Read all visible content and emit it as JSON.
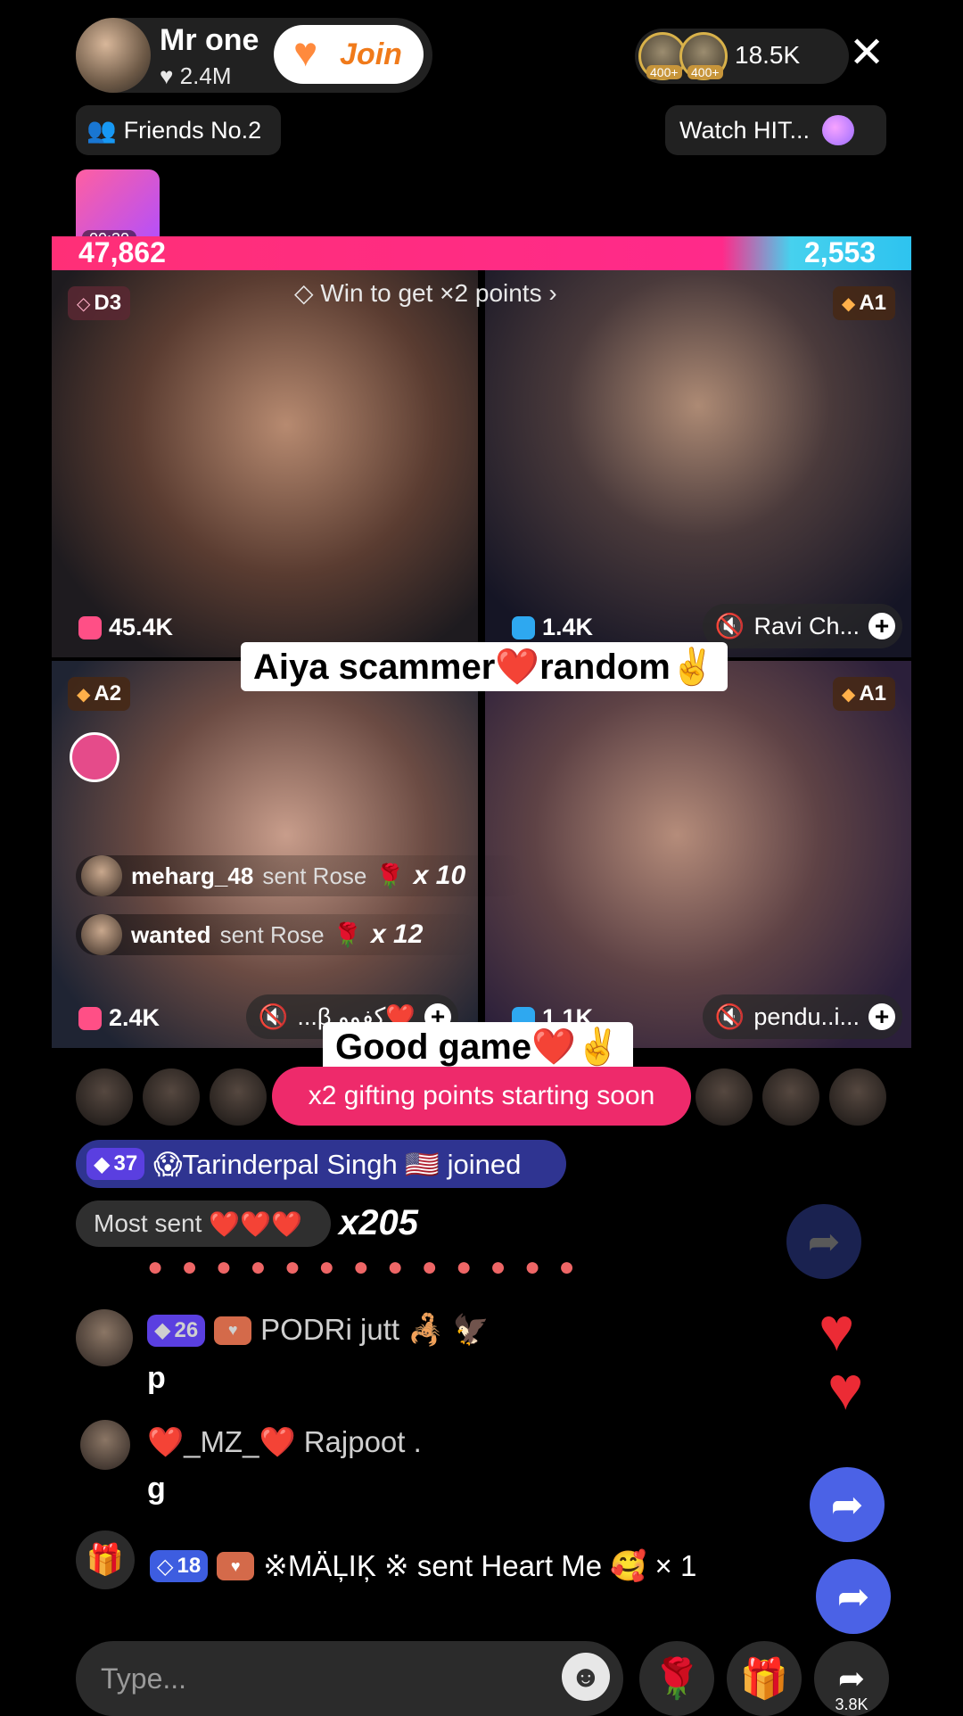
{
  "header": {
    "host_name": "Mr one",
    "host_likes": "2.4M",
    "join_label": "Join",
    "viewer_badges": [
      "400+",
      "400+"
    ],
    "viewer_count": "18.5K",
    "close_glyph": "✕"
  },
  "tags": {
    "friends": "Friends No.2",
    "watch": "Watch HIT..."
  },
  "treasure_timer": "00:30",
  "battle": {
    "left_score": "47,862",
    "right_score": "2,553",
    "win_banner": "Win to get ×2 points"
  },
  "tiles": [
    {
      "rank": "D3",
      "count": "45.4K",
      "name": ""
    },
    {
      "rank": "A1",
      "count": "1.4K",
      "name": "Ravi Ch..."
    },
    {
      "rank": "A2",
      "count": "2.4K",
      "name": "...β كفوو❤️"
    },
    {
      "rank": "A1",
      "count": "1.1K",
      "name": "pendu..i..."
    }
  ],
  "captions": {
    "caption1": "Aiya scammer❤️random✌️",
    "caption2": "Good game❤️✌️"
  },
  "gift_popups": [
    {
      "user": "meharg_48",
      "text": "sent Rose",
      "multiplier": "x 10"
    },
    {
      "user": "wanted",
      "text": "sent Rose",
      "multiplier": "x 12"
    }
  ],
  "banner": "x2 gifting points starting soon",
  "joined": {
    "level": "37",
    "text": "😱Tarinderpal Singh 🇺🇸 joined"
  },
  "most_sent": {
    "label": "Most sent",
    "hearts": "❤️❤️❤️",
    "count": "x205"
  },
  "chat": [
    {
      "level": "26",
      "name": "PODRi jutt 🦂 🦅",
      "message": "p"
    },
    {
      "level": "",
      "name": "❤️_MZ_❤️ Rajpoot .",
      "message": "g"
    },
    {
      "level": "18",
      "name": "※MÄĻIĶ ※ sent Heart Me 🥰 × 1",
      "message": ""
    }
  ],
  "input": {
    "placeholder": "Type..."
  },
  "share_count": "3.8K",
  "icons": {
    "heart": "heart-icon",
    "close": "close-icon",
    "gift": "gift-icon",
    "share": "share-icon",
    "rose": "rose-icon",
    "emoji": "emoji-icon"
  },
  "colors": {
    "accent_pink": "#ee2a6b",
    "join_orange": "#f07a1a",
    "share_blue": "#4b62e6"
  }
}
